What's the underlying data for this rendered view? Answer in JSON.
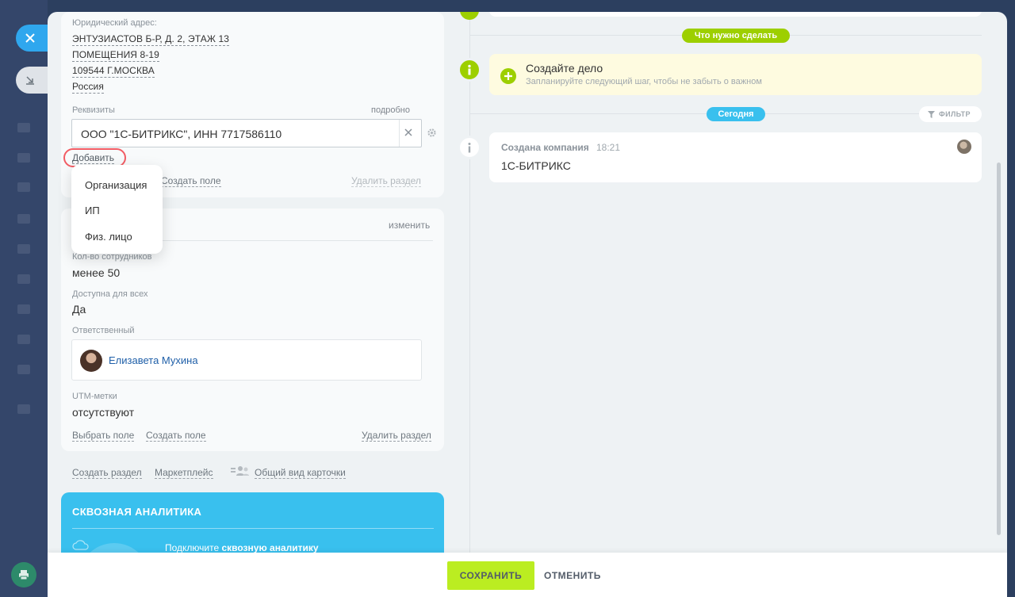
{
  "left_column": {
    "legal_address": {
      "label": "Юридический адрес:",
      "lines": [
        "ЭНТУЗИАСТОВ Б-Р, Д. 2, ЭТАЖ 13",
        "ПОМЕЩЕНИЯ 8-19",
        "109544 Г.МОСКВА",
        "Россия"
      ]
    },
    "requisites": {
      "label": "Реквизиты",
      "details_link": "подробно",
      "value": "ООО \"1С-БИТРИКС\", ИНН 7717586110",
      "add_button": "Добавить",
      "dropdown_items": [
        "Организация",
        "ИП",
        "Физ. лицо"
      ]
    },
    "section1_links": {
      "create_field": "Создать поле",
      "delete_section": "Удалить раздел"
    },
    "section2": {
      "edit_link": "изменить",
      "employees_label": "Кол-во сотрудников",
      "employees_value": "менее 50",
      "available_label": "Доступна для всех",
      "available_value": "Да",
      "responsible_label": "Ответственный",
      "responsible_name": "Елизавета Мухина",
      "utm_label": "UTM-метки",
      "utm_value": "отсутствуют",
      "choose_field": "Выбрать поле",
      "create_field": "Создать поле",
      "delete_section": "Удалить раздел"
    },
    "bottom_links": {
      "create_section": "Создать раздел",
      "marketplace": "Маркетплейс",
      "common_view": "Общий вид карточки"
    },
    "analytics": {
      "title": "СКВОЗНАЯ АНАЛИТИКА",
      "text_prefix": "Подключите ",
      "text_bold": "сквозную аналитику"
    }
  },
  "timeline": {
    "todo_badge": "Что нужно сделать",
    "task_title": "Создайте дело",
    "task_subtitle": "Запланируйте следующий шаг, чтобы не забыть о важном",
    "today_badge": "Сегодня",
    "filter": "ФИЛЬТР",
    "event_title": "Создана компания",
    "event_time": "18:21",
    "event_body": "1С-БИТРИКС"
  },
  "footer": {
    "save": "СОХРАНИТЬ",
    "cancel": "ОТМЕНИТЬ"
  },
  "colors": {
    "accent_green": "#bbed21",
    "badge_green": "#9dcf00",
    "badge_blue": "#39c0ee",
    "highlight_red": "#f25c64"
  }
}
